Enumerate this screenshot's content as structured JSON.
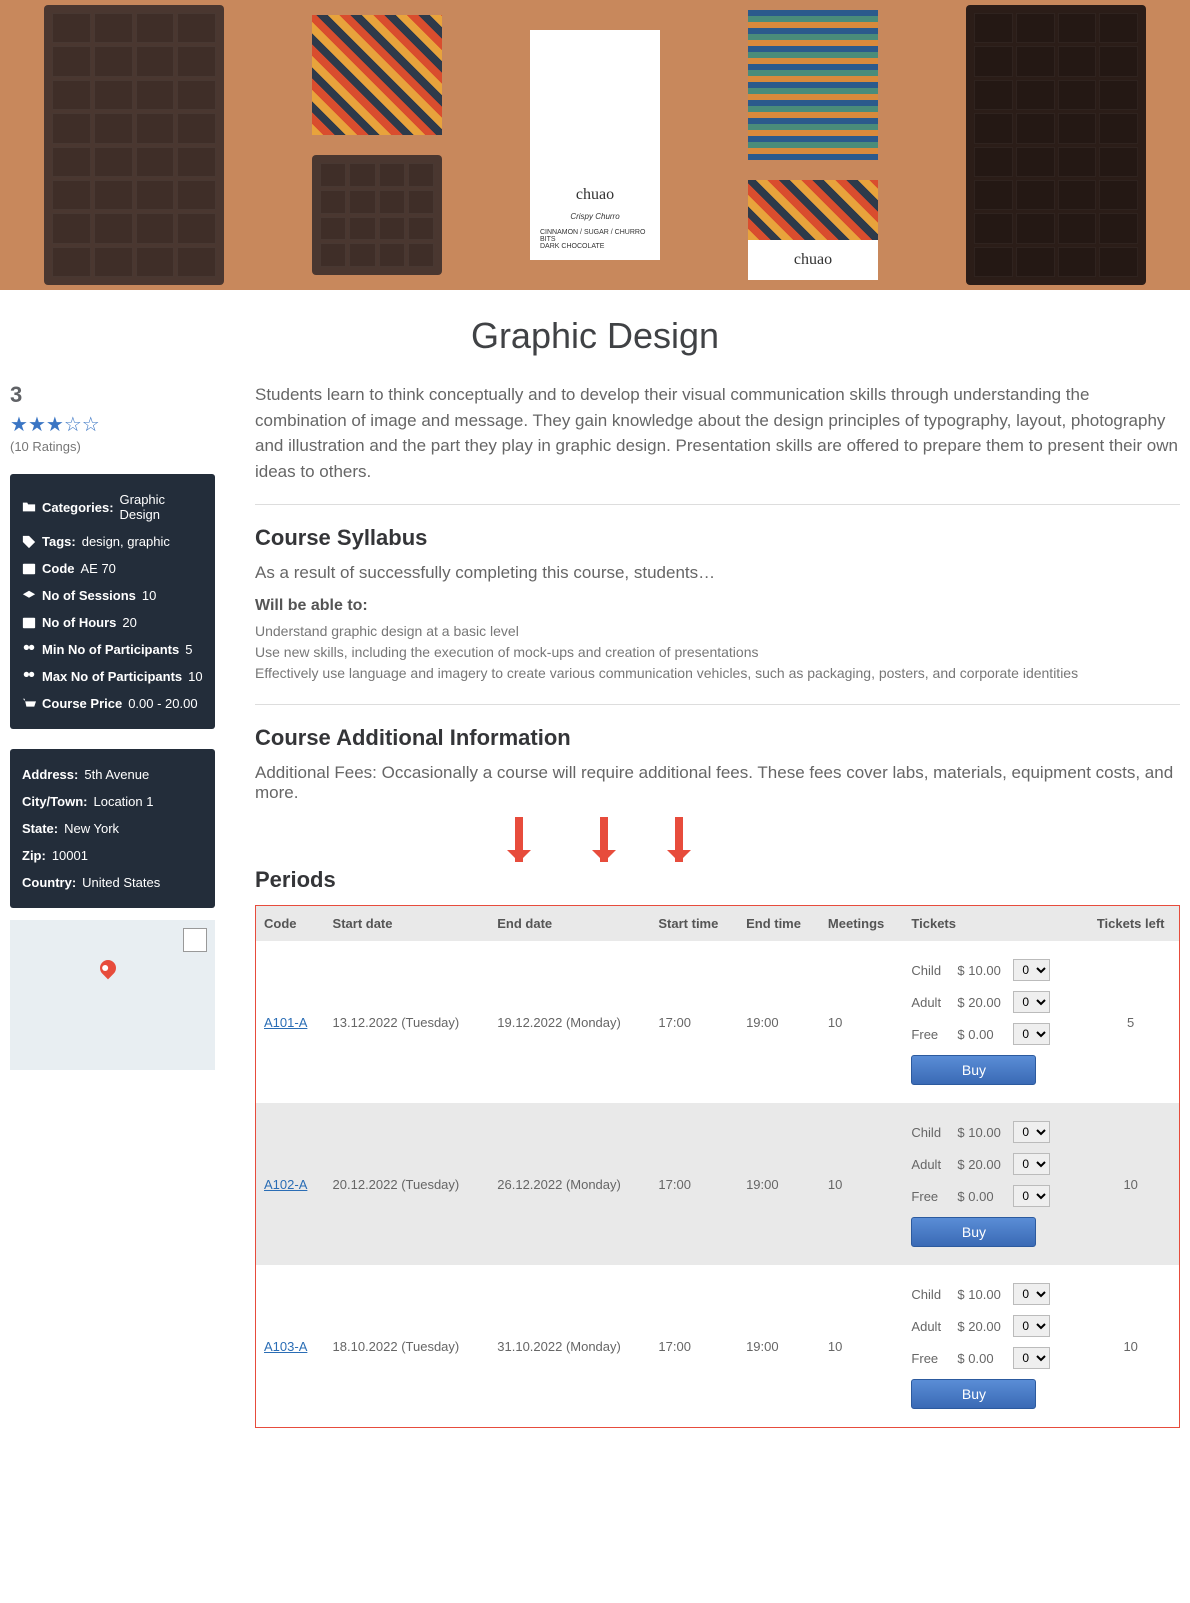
{
  "page_title": "Graphic Design",
  "rating": {
    "score": "3",
    "count_text": "(10 Ratings)"
  },
  "meta": {
    "categories_label": "Categories:",
    "categories": "Graphic Design",
    "tags_label": "Tags:",
    "tags": "design, graphic",
    "code_label": "Code",
    "code": "AE 70",
    "sessions_label": "No of Sessions",
    "sessions": "10",
    "hours_label": "No of Hours",
    "hours": "20",
    "min_label": "Min No of Participants",
    "min": "5",
    "max_label": "Max No of Participants",
    "max": "10",
    "price_label": "Course Price",
    "price": "0.00 - 20.00"
  },
  "address": {
    "address_label": "Address:",
    "address": "5th Avenue",
    "city_label": "City/Town:",
    "city": "Location 1",
    "state_label": "State:",
    "state": "New York",
    "zip_label": "Zip:",
    "zip": "10001",
    "country_label": "Country:",
    "country": "United States"
  },
  "description": "Students learn to think conceptually and to develop their visual communication skills through understanding the combination of image and message. They gain knowledge about the design principles of typography, layout, photography and illustration and the part they play in graphic design. Presentation skills are offered to prepare them to present their own ideas to others.",
  "syllabus": {
    "heading": "Course Syllabus",
    "intro": "As a result of successfully completing this course, students…",
    "able_heading": "Will be able to:",
    "lines": [
      "Understand graphic design at a basic level",
      "Use new skills, including the execution of mock-ups and creation of presentations",
      "Effectively use language and imagery to create various communication vehicles, such as packaging, posters, and corporate identities"
    ]
  },
  "additional": {
    "heading": "Course Additional Information",
    "text": "Additional Fees: Occasionally a course will require additional fees. These fees cover labs, materials, equipment costs, and more."
  },
  "periods": {
    "heading": "Periods",
    "headers": [
      "Code",
      "Start date",
      "End date",
      "Start time",
      "End time",
      "Meetings",
      "Tickets",
      "Tickets left"
    ],
    "buy_label": "Buy",
    "ticket_types": [
      {
        "name": "Child",
        "price": "$ 10.00"
      },
      {
        "name": "Adult",
        "price": "$ 20.00"
      },
      {
        "name": "Free",
        "price": "$ 0.00"
      }
    ],
    "rows": [
      {
        "code": "A101-A",
        "start": "13.12.2022 (Tuesday)",
        "end": "19.12.2022 (Monday)",
        "st": "17:00",
        "et": "19:00",
        "mtg": "10",
        "left": "5"
      },
      {
        "code": "A102-A",
        "start": "20.12.2022 (Tuesday)",
        "end": "26.12.2022 (Monday)",
        "st": "17:00",
        "et": "19:00",
        "mtg": "10",
        "left": "10"
      },
      {
        "code": "A103-A",
        "start": "18.10.2022 (Tuesday)",
        "end": "31.10.2022 (Monday)",
        "st": "17:00",
        "et": "19:00",
        "mtg": "10",
        "left": "10"
      }
    ]
  }
}
